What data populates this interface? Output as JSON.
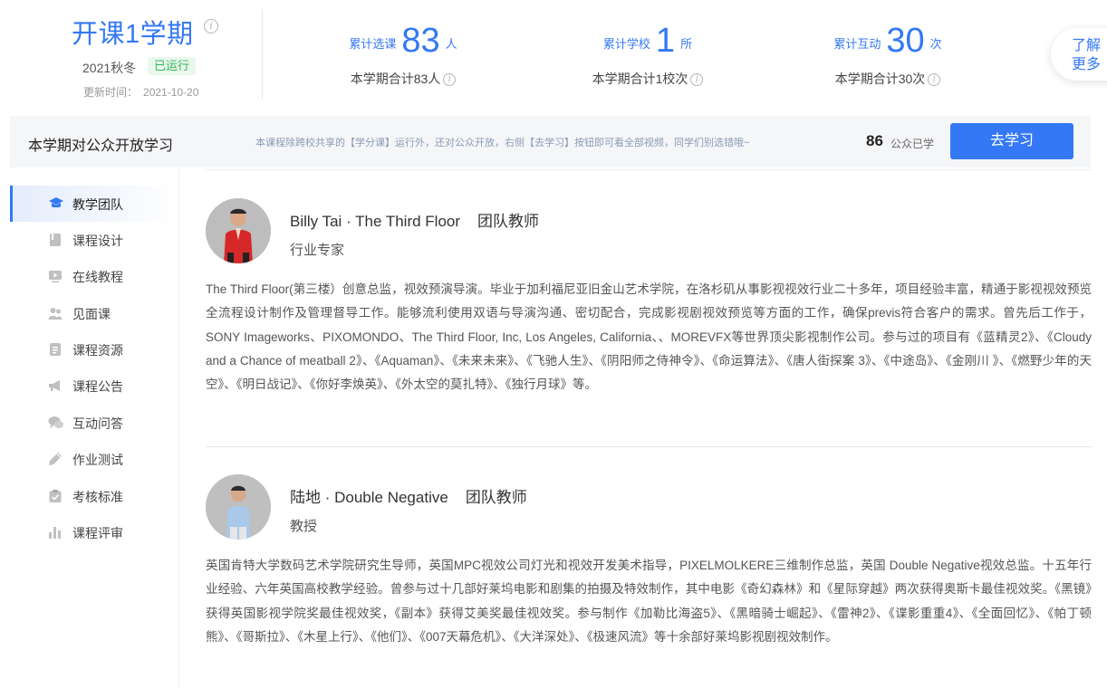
{
  "semester": {
    "title": "开课1学期",
    "term": "2021秋冬",
    "status": "已运行",
    "update_label": "更新时间：",
    "update_time": "2021-10-20"
  },
  "stats": [
    {
      "label": "累计选课",
      "value": "83",
      "unit": "人",
      "sub": "本学期合计83人"
    },
    {
      "label": "累计学校",
      "value": "1",
      "unit": "所",
      "sub": "本学期合计1校次"
    },
    {
      "label": "累计互动",
      "value": "30",
      "unit": "次",
      "sub": "本学期合计30次"
    }
  ],
  "more_button": {
    "line1": "了解",
    "line2": "更多"
  },
  "public_bar": {
    "title": "本学期对公众开放学习",
    "description": "本课程除跨校共享的【学分课】运行外，还对公众开放，右侧【去学习】按钮即可看全部视频，同学们别选错哦~",
    "count": "86",
    "count_label": "公众已学",
    "button": "去学习"
  },
  "sidebar": {
    "items": [
      {
        "label": "教学团队",
        "icon": "graduation-cap-icon",
        "active": true
      },
      {
        "label": "课程设计",
        "icon": "book-icon"
      },
      {
        "label": "在线教程",
        "icon": "video-icon"
      },
      {
        "label": "见面课",
        "icon": "people-icon"
      },
      {
        "label": "课程资源",
        "icon": "document-icon"
      },
      {
        "label": "课程公告",
        "icon": "megaphone-icon"
      },
      {
        "label": "互动问答",
        "icon": "chat-icon"
      },
      {
        "label": "作业测试",
        "icon": "pencil-icon"
      },
      {
        "label": "考核标准",
        "icon": "clipboard-check-icon"
      },
      {
        "label": "课程评审",
        "icon": "bar-chart-icon"
      }
    ]
  },
  "teachers": [
    {
      "name": "Billy Tai · The Third Floor",
      "role": "团队教师",
      "title": "行业专家",
      "description": "The Third Floor(第三楼）创意总监，视效预演导演。毕业于加利福尼亚旧金山艺术学院，在洛杉矶从事影视视效行业二十多年，项目经验丰富，精通于影视视效预览全流程设计制作及管理督导工作。能够流利使用双语与导演沟通、密切配合，完成影视剧视效预览等方面的工作，确保previs符合客户的需求。曾先后工作于，SONY Imageworks、PIXOMONDO、The Third Floor, Inc, Los Angeles, California、、MOREVFX等世界顶尖影视制作公司。参与过的项目有《蓝精灵2》、《Cloudy and a Chance of meatball 2》、《Aquaman》、《未来未来》、《飞驰人生》、《阴阳师之侍神令》、《命运算法》、《唐人街探案 3》、《中途岛》、《金刚川 》、《燃野少年的天空》、《明日战记》、《你好李焕英》、《外太空的莫扎特》、《独行月球》等。"
    },
    {
      "name": "陆地 · Double Negative",
      "role": "团队教师",
      "title": "教授",
      "description": "英国肯特大学数码艺术学院研究生导师，英国MPC视效公司灯光和视效开发美术指导，PIXELMOLKERE三维制作总监，英国 Double Negative视效总监。十五年行业经验、六年英国高校教学经验。曾参与过十几部好莱坞电影和剧集的拍摄及特效制作，其中电影《奇幻森林》和《星际穿越》两次获得奥斯卡最佳视效奖。《黑镜》获得英国影视学院奖最佳视效奖，《副本》获得艾美奖最佳视效奖。参与制作《加勒比海盗5》、《黑暗骑士崛起》、《雷神2》、《谍影重重4》、《全面回忆》、《帕丁顿熊》、《哥斯拉》、《木星上行》、《他们》、《007天幕危机》、《大洋深处》、《极速风流》等十余部好莱坞影视剧视效制作。"
    }
  ],
  "colors": {
    "accent": "#3478f6",
    "status_green": "#35b558",
    "bar_bg": "#f5f6f8"
  }
}
